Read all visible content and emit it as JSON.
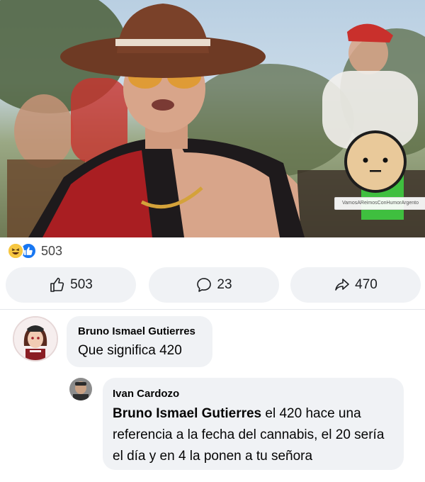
{
  "post": {
    "watermark": "VamosAReimosConHumorArgento",
    "reaction_count": "503"
  },
  "actions": {
    "like_count": "503",
    "comment_count": "23",
    "share_count": "470"
  },
  "comments": [
    {
      "author": "Bruno Ismael Gutierres",
      "text": "Que significa 420"
    },
    {
      "author": "Ivan Cardozo",
      "mention": "Bruno Ismael Gutierres",
      "text": " el 420 hace una referencia a la fecha del cannabis, el 20 sería el día y en 4 la ponen a tu señora"
    }
  ],
  "colors": {
    "like_blue": "#1877f2",
    "haha_yellow": "#f7c741",
    "bubble_bg": "#f0f2f5"
  },
  "icons": [
    "haha-reaction-icon",
    "like-reaction-icon",
    "thumbs-up-icon",
    "comment-icon",
    "share-icon"
  ]
}
